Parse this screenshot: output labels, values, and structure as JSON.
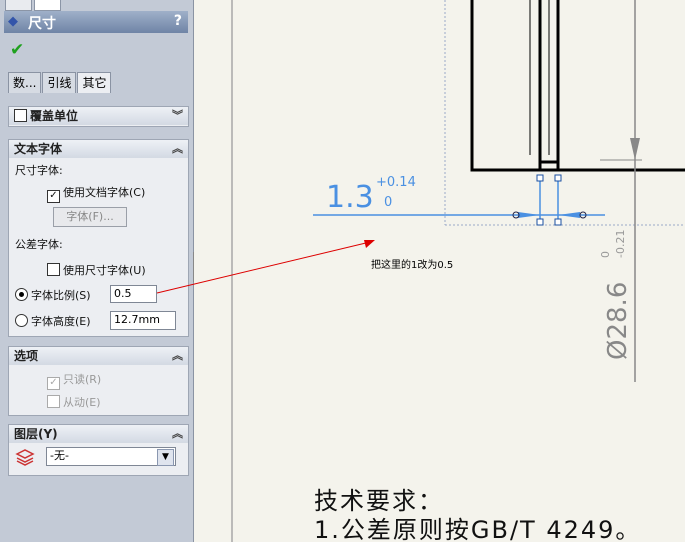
{
  "panel": {
    "title": "尺寸",
    "help": "?",
    "tabs": [
      "数...",
      "引线",
      "其它"
    ],
    "override_units": {
      "label": "覆盖单位"
    },
    "text_font": {
      "header": "文本字体",
      "dim_font_label": "尺寸字体:",
      "use_doc_font": "使用文档字体(C)",
      "font_button": "字体(F)...",
      "tol_font_label": "公差字体:",
      "use_dim_font": "使用尺寸字体(U)",
      "font_scale_label": "字体比例(S)",
      "font_scale_value": "0.5",
      "font_height_label": "字体高度(E)",
      "font_height_value": "12.7mm"
    },
    "options": {
      "header": "选项",
      "read_only": "只读(R)",
      "driven": "从动(E)"
    },
    "layer": {
      "header": "图层(Y)",
      "value": "-无-"
    }
  },
  "drawing": {
    "dim_value": "1.3",
    "tol_upper": "+0.14",
    "tol_lower": "0",
    "note": "把这里的1改为0.5",
    "vdim_value": "Ø28.6",
    "vtol_upper": "0",
    "vtol_lower": "-0.21",
    "req_title": "技术要求：",
    "req_line1": "1.公差原则按GB/T 4249。"
  },
  "colors": {
    "accent": "#4a90e2",
    "arrow": "#dd0000"
  }
}
